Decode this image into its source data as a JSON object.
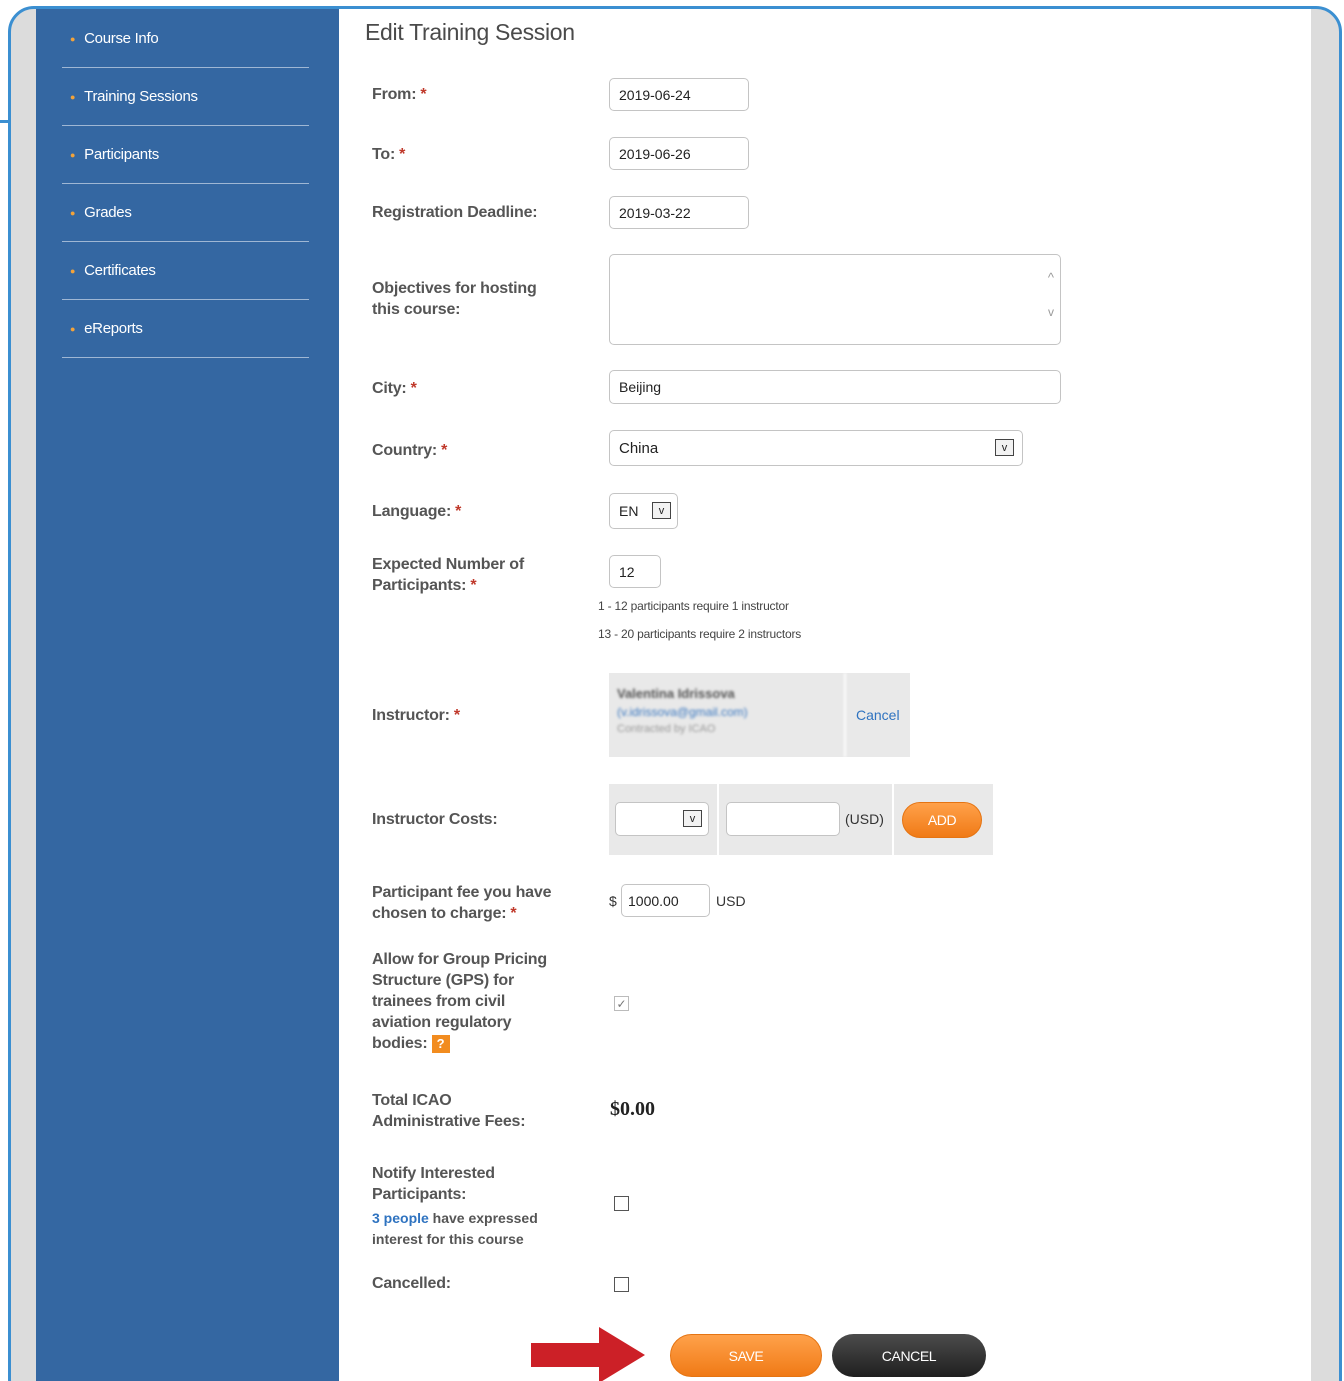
{
  "sidebar": {
    "items": [
      {
        "label": "Course Info"
      },
      {
        "label": "Training Sessions"
      },
      {
        "label": "Participants"
      },
      {
        "label": "Grades"
      },
      {
        "label": "Certificates"
      },
      {
        "label": "eReports"
      }
    ]
  },
  "page": {
    "title": "Edit Training Session"
  },
  "form": {
    "from": {
      "label": "From:",
      "value": "2019-06-24"
    },
    "to": {
      "label": "To:",
      "value": "2019-06-26"
    },
    "deadline": {
      "label": "Registration Deadline:",
      "value": "2019-03-22"
    },
    "objectives": {
      "label_line1": "Objectives for hosting",
      "label_line2": "this course:",
      "value": ""
    },
    "city": {
      "label": "City:",
      "value": "Beijing"
    },
    "country": {
      "label": "Country:",
      "value": "China"
    },
    "language": {
      "label": "Language:",
      "value": "EN"
    },
    "participants": {
      "label_line1": "Expected Number of",
      "label_line2": "Participants:",
      "value": "12",
      "hint1": "1 - 12 participants require 1 instructor",
      "hint2": "13 - 20 participants require 2 instructors"
    },
    "instructor": {
      "label": "Instructor:",
      "name": "Valentina Idrissova",
      "email": "(v.idrissova@gmail.com)",
      "contract": "Contracted by ICAO",
      "cancel_label": "Cancel"
    },
    "instructor_costs": {
      "label": "Instructor Costs:",
      "select_value": "",
      "amount": "",
      "currency": "(USD)",
      "add_label": "ADD"
    },
    "fee": {
      "label_line1": "Participant fee you have",
      "label_line2": "chosen to charge:",
      "prefix": "$",
      "value": "1000.00",
      "currency": "USD"
    },
    "gps": {
      "label_line1": "Allow for Group Pricing",
      "label_line2": "Structure (GPS) for",
      "label_line3": "trainees from civil",
      "label_line4": "aviation regulatory",
      "label_line5": "bodies:",
      "help": "?",
      "checked": true,
      "check_glyph": "✓"
    },
    "admin_fees": {
      "label_line1": "Total ICAO",
      "label_line2": "Administrative Fees:",
      "value": "$0.00"
    },
    "notify": {
      "label_line1": "Notify Interested",
      "label_line2": "Participants:",
      "people_link": "3 people",
      "note_line1": " have expressed",
      "note_line2": "interest for this course",
      "checked": false
    },
    "cancelled": {
      "label": "Cancelled:",
      "checked": false
    },
    "required_mark": "*",
    "chevron_glyph": "v",
    "scroll_up_glyph": "^",
    "scroll_down_glyph": "v"
  },
  "actions": {
    "save_label": "SAVE",
    "cancel_label": "CANCEL"
  },
  "colors": {
    "sidebar": "#3467a2",
    "accent_orange": "#f28c1f",
    "frame_blue": "#3b8fd1",
    "arrow_red": "#cc2027"
  }
}
